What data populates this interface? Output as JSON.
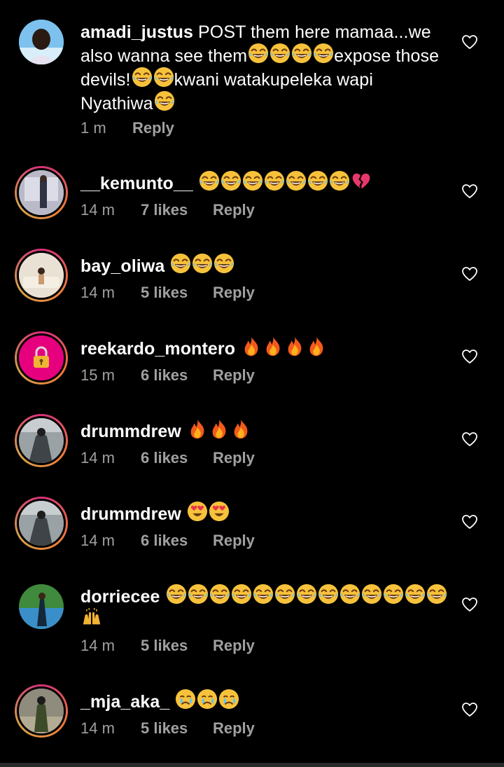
{
  "comments": [
    {
      "username": "amadi_justus",
      "text_parts": [
        "POST them here mamaa...we also wanna see them",
        "expose those devils!",
        "kwani watakupeleka wapi Nyathiwa"
      ],
      "time": "1 m",
      "likes": "",
      "reply": "Reply",
      "avatar": "person-portrait"
    },
    {
      "username": "__kemunto__",
      "time": "14 m",
      "likes": "7 likes",
      "reply": "Reply",
      "emojis": "laughing x7, broken-heart"
    },
    {
      "username": "bay_oliwa",
      "time": "14 m",
      "likes": "5 likes",
      "reply": "Reply",
      "emojis": "laughing x3"
    },
    {
      "username": "reekardo_montero",
      "time": "15 m",
      "likes": "6 likes",
      "reply": "Reply",
      "emojis": "fire x4"
    },
    {
      "username": "drummdrew",
      "time": "14 m",
      "likes": "6 likes",
      "reply": "Reply",
      "emojis": "fire x3"
    },
    {
      "username": "drummdrew",
      "time": "14 m",
      "likes": "6 likes",
      "reply": "Reply",
      "emojis": "heart-eyes x2"
    },
    {
      "username": "dorriecee",
      "time": "14 m",
      "likes": "5 likes",
      "reply": "Reply",
      "emojis": "laughing x13, raised-hands"
    },
    {
      "username": "_mja_aka_",
      "time": "14 m",
      "likes": "5 likes",
      "reply": "Reply",
      "emojis": "crying x3"
    }
  ],
  "colors": {
    "background": "#000000",
    "meta": "#a0a0a0",
    "story_ring": "#d62f7a"
  }
}
